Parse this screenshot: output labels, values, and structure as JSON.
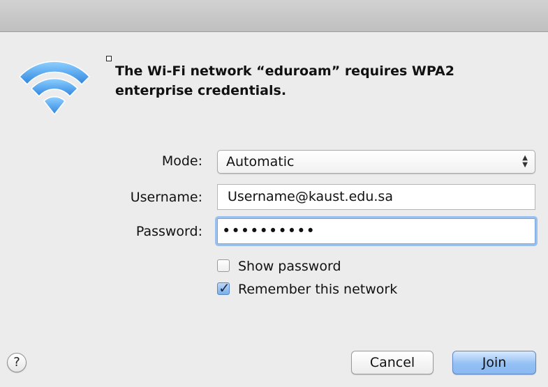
{
  "dialog": {
    "message": "The Wi-Fi network “eduroam” requires WPA2 enterprise credentials.",
    "icon": "wifi-icon"
  },
  "form": {
    "mode_label": "Mode:",
    "mode_value": "Automatic",
    "username_label": "Username:",
    "username_value": "Username@kaust.edu.sa",
    "password_label": "Password:",
    "password_value": "••••••••••"
  },
  "options": {
    "show_password_label": "Show password",
    "show_password_checked": false,
    "remember_network_label": "Remember this network",
    "remember_network_checked": true
  },
  "buttons": {
    "help_label": "?",
    "cancel_label": "Cancel",
    "join_label": "Join"
  },
  "colors": {
    "wifi_blue": "#4a9fe8",
    "focus_ring": "#9ac0ee",
    "default_button": "#93c0f4"
  }
}
